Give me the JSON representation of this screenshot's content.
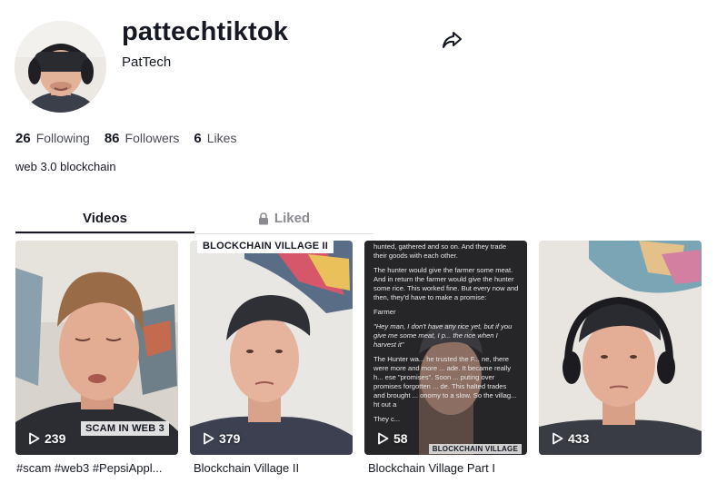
{
  "profile": {
    "username": "pattechtiktok",
    "nickname": "PatTech",
    "bio": "web 3.0 blockchain"
  },
  "stats": [
    {
      "value": "26",
      "label": "Following"
    },
    {
      "value": "86",
      "label": "Followers"
    },
    {
      "value": "6",
      "label": "Likes"
    }
  ],
  "tabs": {
    "videos": "Videos",
    "liked": "Liked"
  },
  "videos": [
    {
      "views": "239",
      "caption": "#scam #web3 #PepsiAppl...",
      "overlay": "SCAM IN WEB 3"
    },
    {
      "views": "379",
      "caption": "Blockchain Village II",
      "overlay": "BLOCKCHAIN VILLAGE II"
    },
    {
      "views": "58",
      "caption": "Blockchain Village Part I",
      "overlay": "BLOCKCHAIN VILLAGE"
    },
    {
      "views": "433",
      "caption": "",
      "overlay": ""
    }
  ],
  "story": {
    "line1": "hunted, gathered and so on. And they trade their goods with each other.",
    "line2": "The hunter would give the farmer some meat. And in return the farmer would give the hunter some rice. This worked fine. But every now and then, they'd have to make a promise:",
    "line3": "Farmer",
    "line4": "\"Hey man, I don't have any rice yet, but if you give me some meat, I p... the rice when I harvest it\"",
    "line5": "The Hunter wa... he trusted the F... ne, there were more and more ... ade. It became really h... ese \"promises\". Soon ... puting over promises forgotten ... de. This halted trades and brought ... onomy to a slow.  So the villag... ht out a",
    "line6": "They c..."
  },
  "colors": {
    "text": "#161823",
    "muted": "#8a8b91",
    "divider": "#e3e3e4"
  },
  "icons": {
    "share": "share-arrow-icon",
    "lock": "lock-icon",
    "play": "play-outline-icon"
  }
}
